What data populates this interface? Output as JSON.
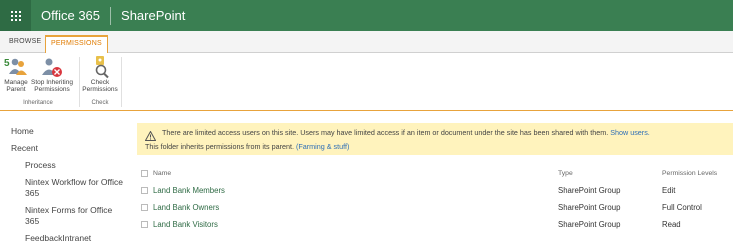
{
  "suitebar": {
    "brand": "Office 365",
    "app": "SharePoint"
  },
  "ribbon_tabs": [
    "BROWSE",
    "PERMISSIONS"
  ],
  "ribbon": {
    "manage_parent": "Manage Parent",
    "stop_inheriting": "Stop Inheriting Permissions",
    "check_permissions": "Check Permissions",
    "group_inheritance": "Inheritance",
    "group_check": "Check"
  },
  "quicklaunch": {
    "home": "Home",
    "recent": "Recent",
    "items": [
      "Process",
      "Nintex Workflow for Office 365",
      "Nintex Forms for Office 365",
      "FeedbackIntranet"
    ]
  },
  "notice": {
    "line1": "There are limited access users on this site. Users may have limited access if an item or document under the site has been shared with them.",
    "show_users": "Show users.",
    "line2": "This folder inherits permissions from its parent.",
    "parent_link": "(Farming & stuff)"
  },
  "table": {
    "headers": {
      "name": "Name",
      "type": "Type",
      "levels": "Permission Levels"
    },
    "rows": [
      {
        "name": "Land Bank Members",
        "type": "SharePoint Group",
        "level": "Edit"
      },
      {
        "name": "Land Bank Owners",
        "type": "SharePoint Group",
        "level": "Full Control"
      },
      {
        "name": "Land Bank Visitors",
        "type": "SharePoint Group",
        "level": "Read"
      }
    ]
  },
  "colors": {
    "suitebar": "#3a7f52",
    "accent": "#e8a33c",
    "notice_bg": "#fff3bd"
  }
}
